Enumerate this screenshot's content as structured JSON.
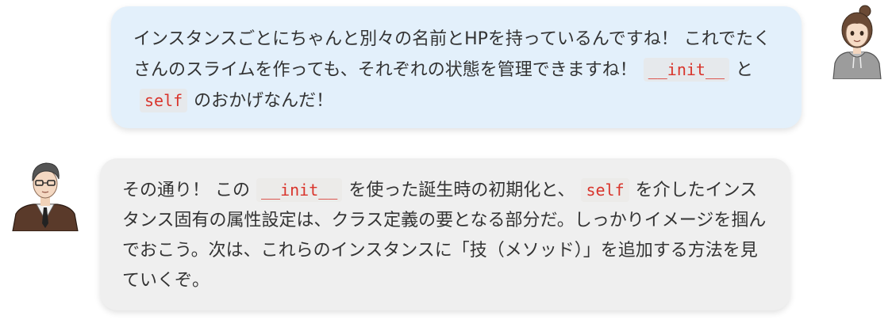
{
  "messages": [
    {
      "speaker": "student",
      "segments": [
        {
          "type": "text",
          "value": "インスタンスごとにちゃんと別々の名前とHPを持っているんですね！ これでたくさんのスライムを作っても、それぞれの状態を管理できますね！"
        },
        {
          "type": "code",
          "value": "__init__"
        },
        {
          "type": "text",
          "value": "と"
        },
        {
          "type": "code",
          "value": "self"
        },
        {
          "type": "text",
          "value": "のおかげなんだ！"
        }
      ]
    },
    {
      "speaker": "teacher",
      "segments": [
        {
          "type": "text",
          "value": "その通り！ この"
        },
        {
          "type": "code",
          "value": "__init__"
        },
        {
          "type": "text",
          "value": "を使った誕生時の初期化と、"
        },
        {
          "type": "code",
          "value": "self"
        },
        {
          "type": "text",
          "value": "を介したインスタンス固有の属性設定は、クラス定義の要となる部分だ。しっかりイメージを掴んでおこう。次は、これらのインスタンスに「技（メソッド）」を追加する方法を見ていくぞ。"
        }
      ]
    }
  ],
  "colors": {
    "student_bubble": "#e3f0fb",
    "teacher_bubble": "#efefef",
    "code_text": "#d9342b",
    "code_bg": "#ecebe9",
    "body_text": "#333333"
  },
  "icons": {
    "student_avatar": "student-avatar-icon",
    "teacher_avatar": "teacher-avatar-icon"
  }
}
